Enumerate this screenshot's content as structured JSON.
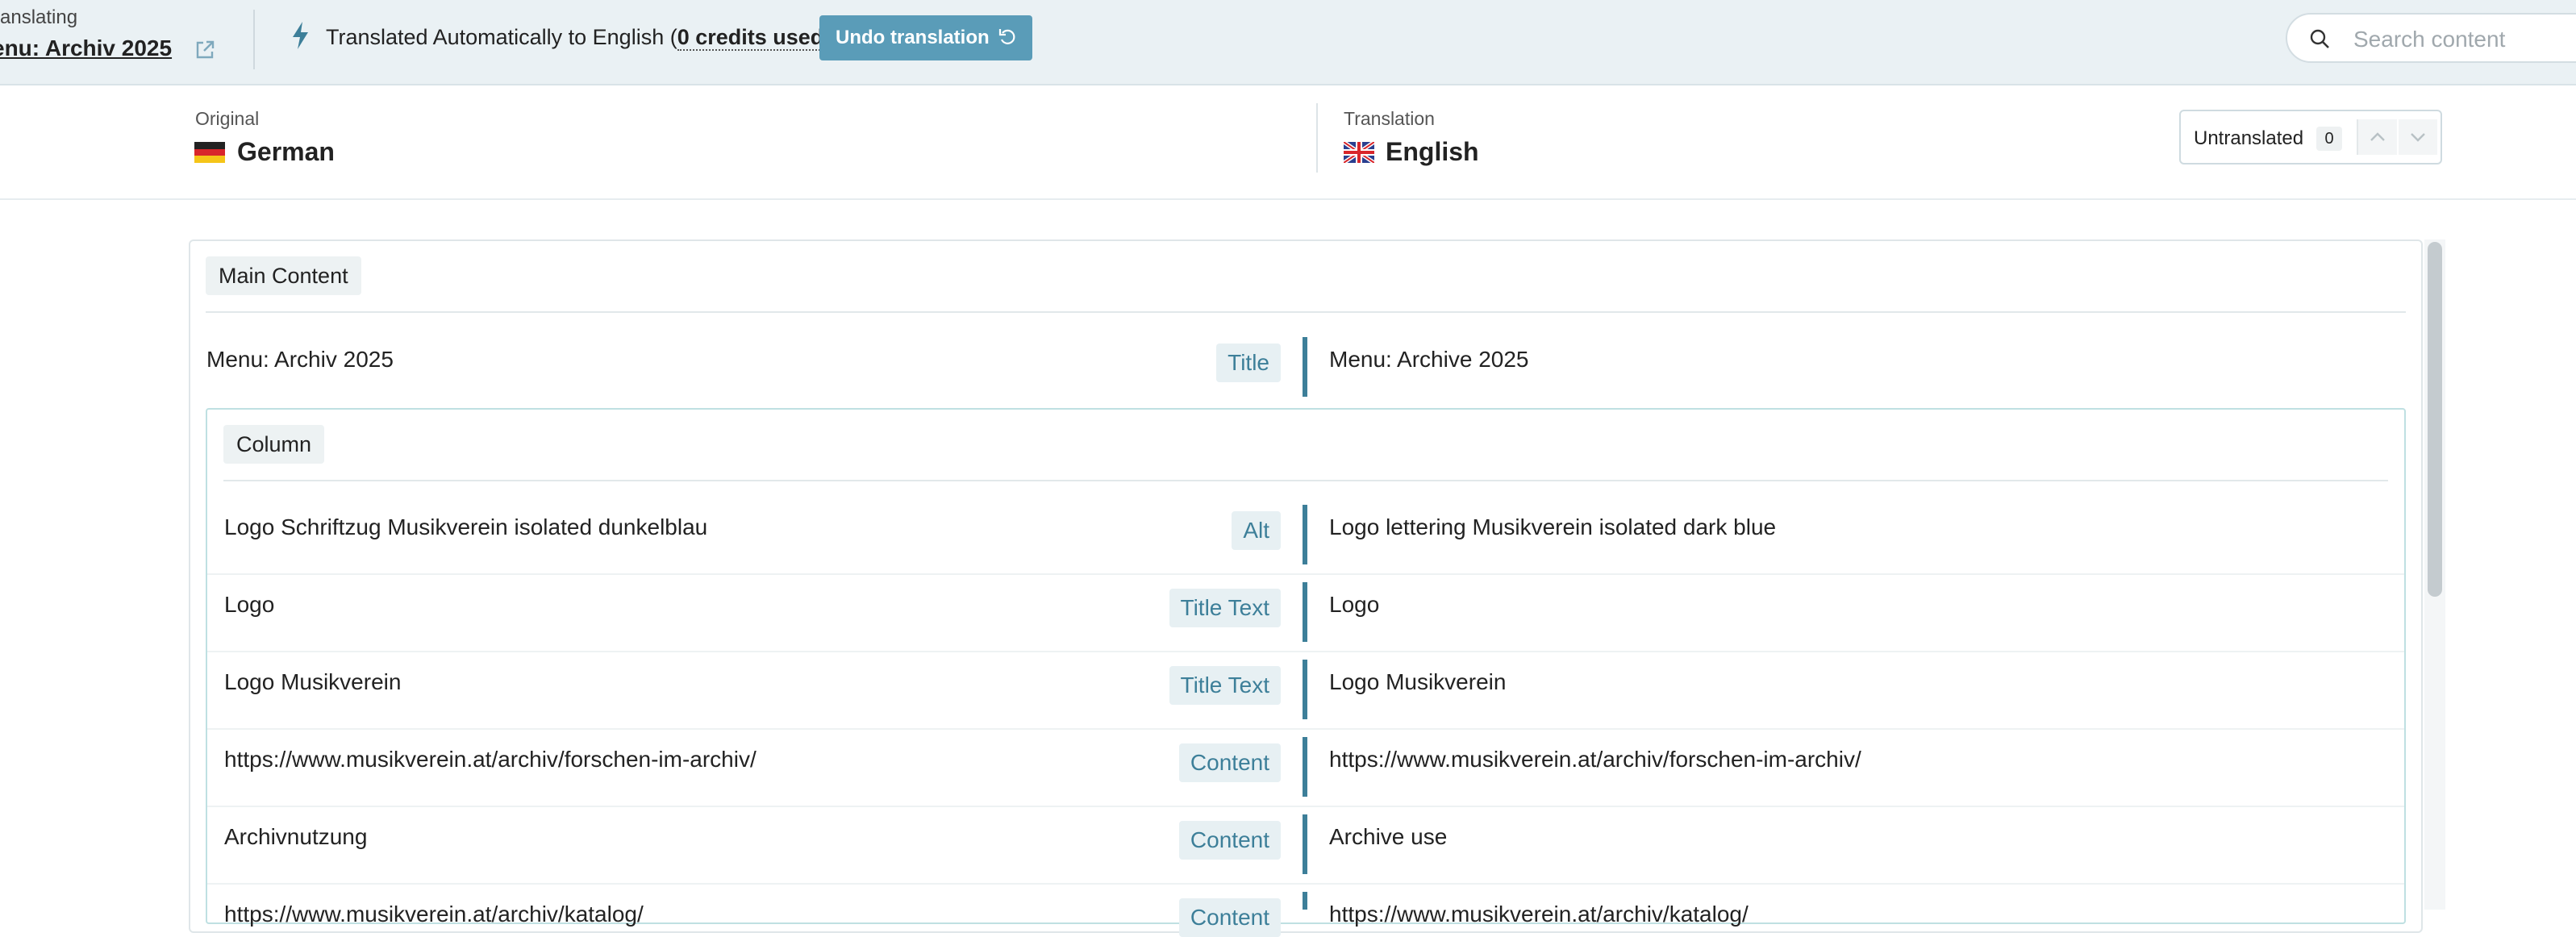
{
  "topbar": {
    "context_label": "ranslating",
    "context_title": "enu: Archiv 2025",
    "auto_prefix": "Translated Automatically to English (",
    "credits": "0 credits used",
    "auto_suffix": ")",
    "undo_label": "Undo translation",
    "search_placeholder": "Search content"
  },
  "languages": {
    "original_caption": "Original",
    "original_name": "German",
    "translation_caption": "Translation",
    "translation_name": "English",
    "untranslated_label": "Untranslated",
    "untranslated_count": "0"
  },
  "main": {
    "section_label": "Main Content",
    "title_row": {
      "source": "Menu: Archiv 2025",
      "field": "Title",
      "target": "Menu: Archive 2025"
    },
    "column_label": "Column",
    "rows": [
      {
        "source": "Logo Schriftzug Musikverein isolated dunkelblau",
        "field": "Alt",
        "target": "Logo lettering Musikverein isolated dark blue"
      },
      {
        "source": "Logo",
        "field": "Title Text",
        "target": "Logo"
      },
      {
        "source": "Logo Musikverein",
        "field": "Title Text",
        "target": "Logo Musikverein"
      },
      {
        "source": "https://www.musikverein.at/archiv/forschen-im-archiv/",
        "field": "Content",
        "target": "https://www.musikverein.at/archiv/forschen-im-archiv/"
      },
      {
        "source": "Archivnutzung",
        "field": "Content",
        "target": "Archive use"
      },
      {
        "source": "https://www.musikverein.at/archiv/katalog/",
        "field": "Content",
        "target": "https://www.musikverein.at/archiv/katalog/"
      }
    ]
  },
  "colors": {
    "accent": "#3d7f99",
    "button": "#5a9cb8",
    "topbar_bg": "#eaf1f4"
  },
  "icons": [
    "external-link-icon",
    "bolt-icon",
    "undo-icon",
    "search-icon",
    "flag-de-icon",
    "flag-uk-icon",
    "chevron-up-icon",
    "chevron-down-icon"
  ]
}
